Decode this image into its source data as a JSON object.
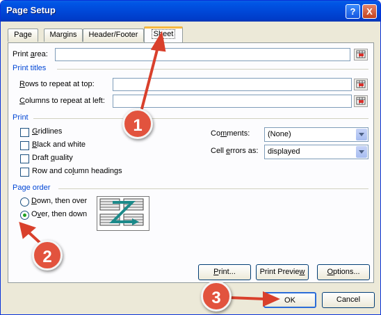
{
  "window": {
    "title": "Page Setup",
    "help_glyph": "?",
    "close_glyph": "X"
  },
  "tabs": [
    {
      "label": "Page"
    },
    {
      "label": "Margins"
    },
    {
      "label": "Header/Footer"
    },
    {
      "label": "Sheet",
      "active": true
    }
  ],
  "print_area": {
    "label_pre": "Print ",
    "label_u": "a",
    "label_post": "rea:",
    "value": ""
  },
  "print_titles": {
    "heading": "Print titles",
    "rows": {
      "label_u": "R",
      "label_post": "ows to repeat at top:",
      "value": ""
    },
    "columns": {
      "label_u": "C",
      "label_post": "olumns to repeat at left:",
      "value": ""
    }
  },
  "print": {
    "heading": "Print",
    "checkboxes": [
      {
        "label_u": "G",
        "label_post": "ridlines",
        "checked": false
      },
      {
        "label_u": "B",
        "label_post": "lack and white",
        "checked": false
      },
      {
        "label_pre": "Draft ",
        "label_u": "q",
        "label_post": "uality",
        "checked": false
      },
      {
        "label_pre": "Row and co",
        "label_u": "l",
        "label_post": "umn headings",
        "checked": false
      }
    ],
    "comments": {
      "label_pre": "Co",
      "label_u": "m",
      "label_post": "ments:",
      "value": "(None)"
    },
    "cell_errors": {
      "label_pre": "Cell ",
      "label_u": "e",
      "label_post": "rrors as:",
      "value": "displayed"
    }
  },
  "page_order": {
    "heading": "Page order",
    "options": [
      {
        "label_u": "D",
        "label_post": "own, then over",
        "selected": false
      },
      {
        "label_pre": "O",
        "label_u": "v",
        "label_post": "er, then down",
        "selected": true
      }
    ]
  },
  "buttons": {
    "print": {
      "label_u": "P",
      "label_post": "rint..."
    },
    "preview": {
      "label_pre": "Print Previe",
      "label_u": "w",
      "label_post": ""
    },
    "options": {
      "label_u": "O",
      "label_post": "ptions..."
    },
    "ok": "OK",
    "cancel": "Cancel"
  },
  "annotations": [
    "1",
    "2",
    "3"
  ],
  "colors": {
    "annotation_red": "#e2533e",
    "group_heading": "#0046d5",
    "title_bar": "#0055e5"
  }
}
